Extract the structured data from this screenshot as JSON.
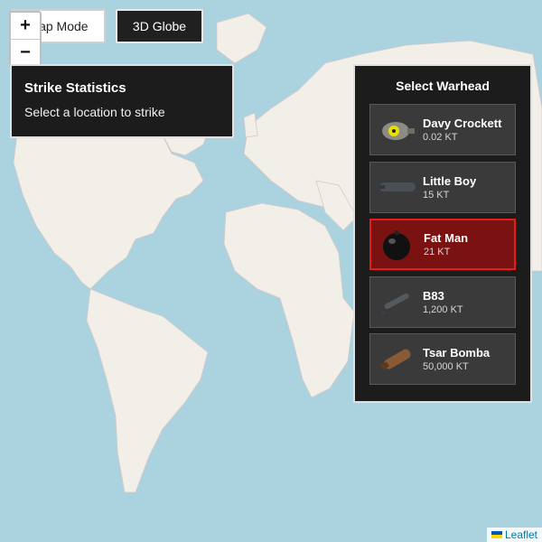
{
  "mode": {
    "map_label": "Map Mode",
    "globe_label": "3D Globe"
  },
  "zoom": {
    "in": "+",
    "out": "−"
  },
  "stats": {
    "title": "Strike Statistics",
    "message": "Select a location to strike"
  },
  "warheads": {
    "title": "Select Warhead",
    "items": [
      {
        "name": "Davy Crockett",
        "yield": "0.02 KT",
        "icon": "davy-crockett-icon",
        "selected": false
      },
      {
        "name": "Little Boy",
        "yield": "15 KT",
        "icon": "little-boy-icon",
        "selected": false
      },
      {
        "name": "Fat Man",
        "yield": "21 KT",
        "icon": "fat-man-icon",
        "selected": true
      },
      {
        "name": "B83",
        "yield": "1,200 KT",
        "icon": "b83-icon",
        "selected": false
      },
      {
        "name": "Tsar Bomba",
        "yield": "50,000 KT",
        "icon": "tsar-bomba-icon",
        "selected": false
      }
    ]
  },
  "attribution": {
    "label": "Leaflet"
  },
  "colors": {
    "ocean": "#aad3df",
    "land": "#f2efe9",
    "selected": "#7a1212",
    "selected_border": "#e21c1c"
  }
}
